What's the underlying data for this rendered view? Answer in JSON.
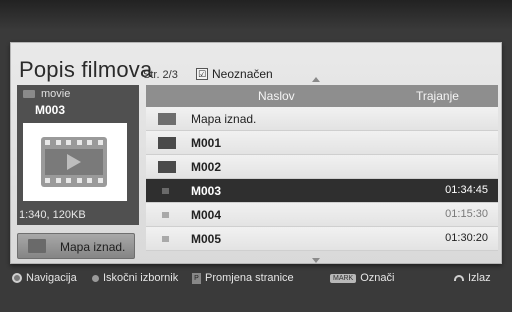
{
  "header": {
    "title": "Popis filmova",
    "page_info": "Str. 2/3",
    "mark_status": "Neoznačen"
  },
  "preview": {
    "folder_label": "movie",
    "file_name": "M003",
    "meta": "1:340, 120KB",
    "parent_button_label": "Mapa iznad."
  },
  "table": {
    "col_title": "Naslov",
    "col_duration": "Trajanje",
    "rows": [
      {
        "name": "Mapa iznad.",
        "duration": ""
      },
      {
        "name": "M001",
        "duration": ""
      },
      {
        "name": "M002",
        "duration": ""
      },
      {
        "name": "M003",
        "duration": "01:34:45"
      },
      {
        "name": "M004",
        "duration": "01:15:30"
      },
      {
        "name": "M005",
        "duration": "01:30:20"
      }
    ]
  },
  "footer": {
    "navigation": "Navigacija",
    "popup_menu": "Iskočni izbornik",
    "page_change": "Promjena stranice",
    "mark_key": "MARK",
    "mark": "Označi",
    "exit": "Izlaz"
  },
  "icons": {
    "folder": "folder-icon",
    "film": "film-icon",
    "play": "play-icon"
  }
}
